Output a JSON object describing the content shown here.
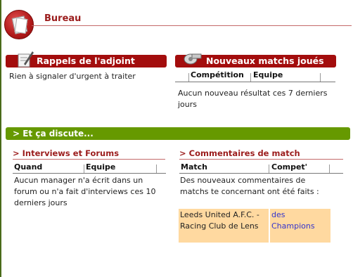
{
  "header": {
    "title": "Bureau",
    "icon": "bureau-icon"
  },
  "rappels": {
    "title": "Rappels de l'adjoint",
    "icon": "quill-icon",
    "message": "Rien à signaler d'urgent à traiter"
  },
  "matchs": {
    "title": "Nouveaux matchs joués",
    "icon": "whistle-icon",
    "columns": [
      "Compétition",
      "Equipe"
    ],
    "message": "Aucun nouveau résultat ces 7 derniers jours"
  },
  "discute": {
    "title": "> Et ça discute..."
  },
  "interviews": {
    "title": "> Interviews et Forums",
    "columns": [
      "Quand",
      "Equipe"
    ],
    "message": "Aucun manager n'a écrit dans un forum ou n'a fait d'interviews ces 10 derniers jours"
  },
  "commentaires": {
    "title": "> Commentaires de match",
    "columns": [
      "Match",
      "Compet'"
    ],
    "message": "Des nouveaux commentaires de matchs te concernant ont été faits :",
    "rows": [
      {
        "match": "Leeds United A.F.C. - Racing Club de Lens",
        "compet": "des Champions"
      }
    ]
  },
  "colors": {
    "red": "#a30d0d",
    "green": "#669900",
    "highlight": "#ffd9a0",
    "link": "#3333cc"
  }
}
